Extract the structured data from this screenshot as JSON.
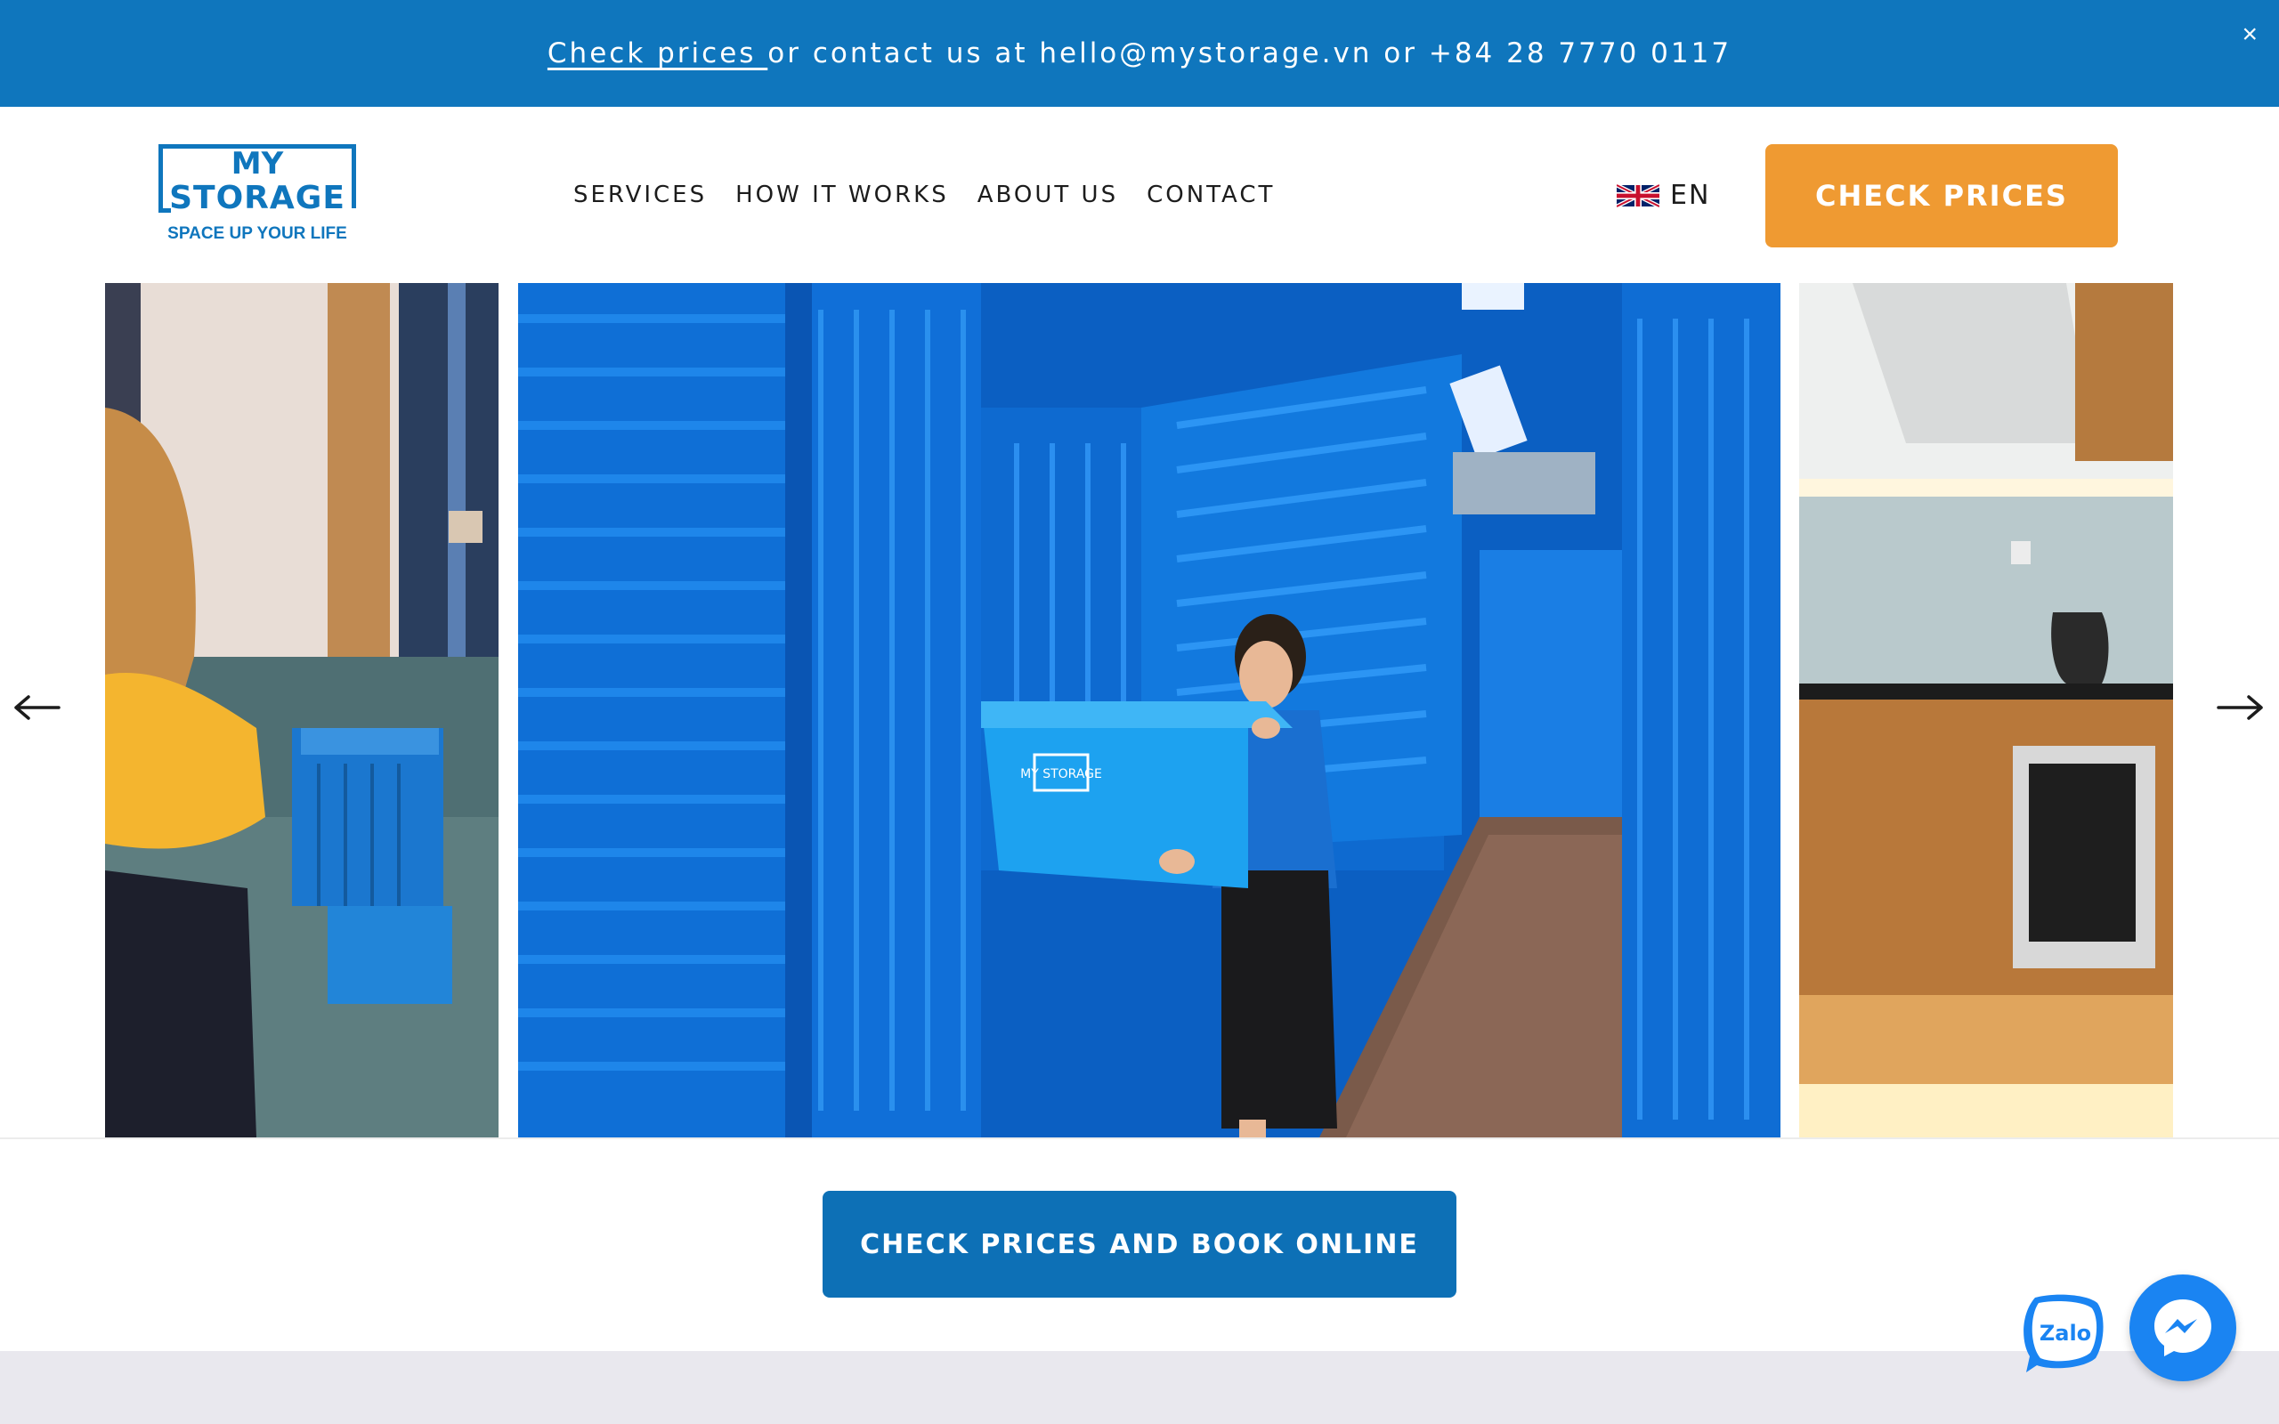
{
  "announcement": {
    "link_text": "Check prices ",
    "text": "or contact us at hello@mystorage.vn or +84 28 7770 0117",
    "close_symbol": "×"
  },
  "header": {
    "logo": {
      "line1": "MY",
      "line2": "STORAGE",
      "tagline": "SPACE UP YOUR LIFE"
    },
    "nav": [
      "SERVICES",
      "HOW IT WORKS",
      "ABOUT US",
      "CONTACT"
    ],
    "language": {
      "code": "EN",
      "flag_icon": "uk-flag-icon"
    },
    "cta_label": "CHECK PRICES"
  },
  "carousel": {
    "prev_icon": "arrow-left-icon",
    "next_icon": "arrow-right-icon",
    "logo_on_box": "MY STORAGE"
  },
  "main_cta": {
    "label": "CHECK PRICES AND BOOK ONLINE"
  },
  "chat": {
    "zalo_label": "Zalo",
    "messenger_icon": "messenger-icon"
  },
  "colors": {
    "brand_blue": "#0f76bd",
    "cta_orange": "#ef9a32",
    "cta_blue": "#0d70b6",
    "messenger_blue": "#1a84f2"
  }
}
